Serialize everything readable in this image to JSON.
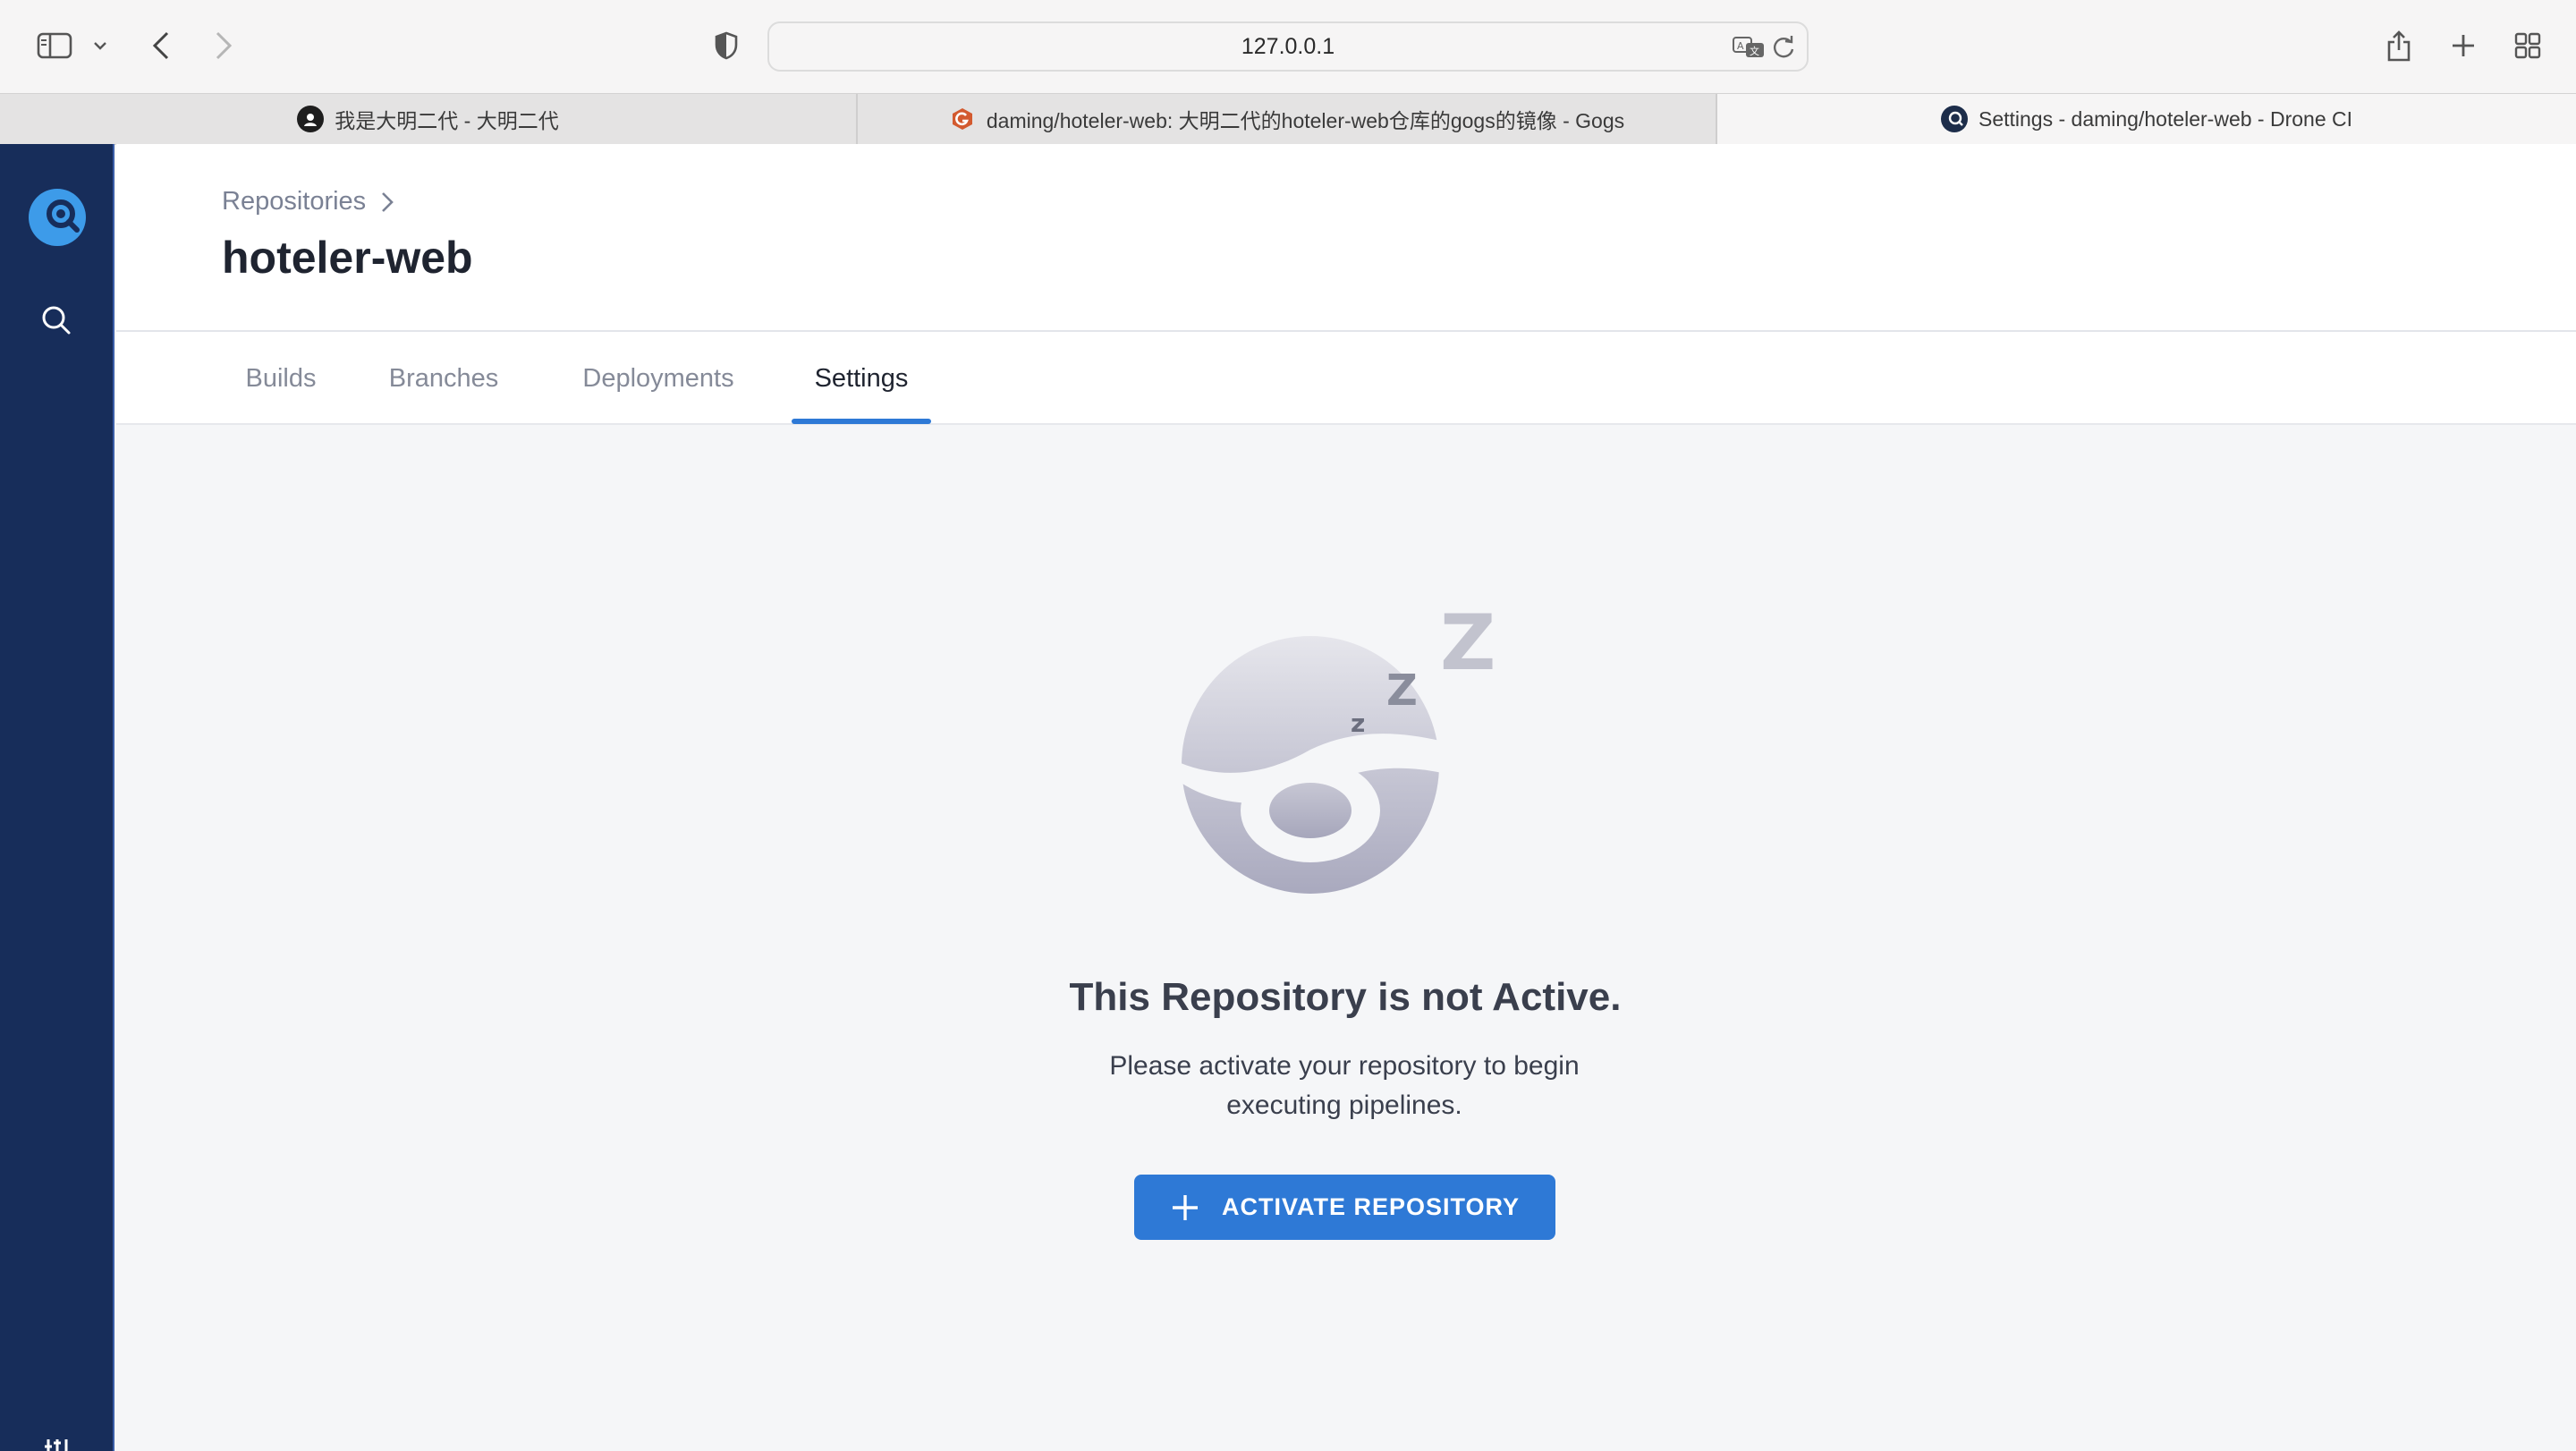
{
  "browser": {
    "url": "127.0.0.1",
    "tabs": [
      {
        "title": "我是大明二代 - 大明二代",
        "icon": "avatar-icon",
        "active": false
      },
      {
        "title": "daming/hoteler-web: 大明二代的hoteler-web仓库的gogs的镜像 - Gogs",
        "icon": "gogs-icon",
        "active": false
      },
      {
        "title": "Settings - daming/hoteler-web - Drone CI",
        "icon": "drone-icon",
        "active": true
      }
    ]
  },
  "header": {
    "breadcrumb": "Repositories",
    "repo_name": "hoteler-web"
  },
  "nav_tabs": [
    {
      "label": "Builds",
      "active": false
    },
    {
      "label": "Branches",
      "active": false
    },
    {
      "label": "Deployments",
      "active": false
    },
    {
      "label": "Settings",
      "active": true
    }
  ],
  "empty_state": {
    "title": "This Repository is not Active.",
    "description": "Please activate your repository to begin executing pipelines.",
    "button_label": "ACTIVATE REPOSITORY"
  },
  "colors": {
    "sidebar": "#172d5a",
    "accent": "#2e79d6",
    "drone_logo": "#3d9be9"
  }
}
